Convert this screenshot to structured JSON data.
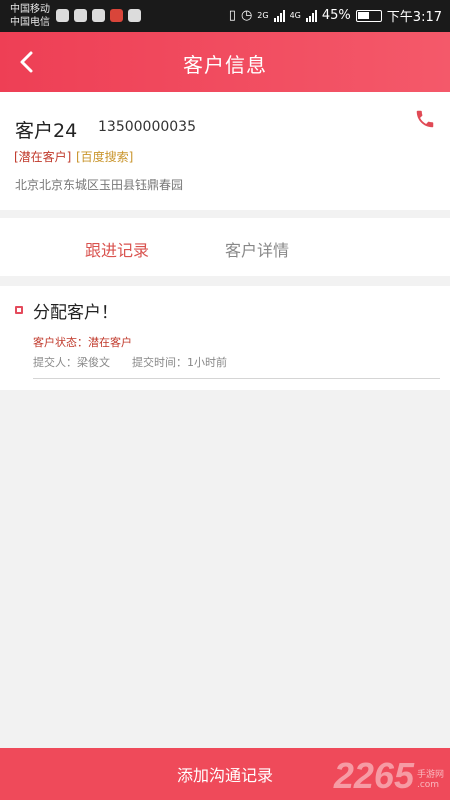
{
  "status_bar": {
    "carrier_1": "中国移动",
    "carrier_2": "中国电信",
    "signal_1_type": "2G",
    "signal_2_type": "4G",
    "battery": "45%",
    "time": "下午3:17"
  },
  "header": {
    "title": "客户信息",
    "back_icon": "chevron-left-icon"
  },
  "customer": {
    "name": "客户24",
    "phone": "13500000035",
    "tag_status": "[潜在客户]",
    "tag_source": "[百度搜索]",
    "address": "北京北京东城区玉田县钰鼎春园",
    "call_icon": "phone-icon"
  },
  "tabs": [
    {
      "label": "跟进记录",
      "active": true
    },
    {
      "label": "客户详情",
      "active": false
    }
  ],
  "records": [
    {
      "title": "分配客户！",
      "status": "客户状态：潜在客户",
      "submitter": "提交人：梁俊文",
      "submit_time": "提交时间：1小时前"
    }
  ],
  "bottom_bar": {
    "label": "添加沟通记录"
  },
  "watermark": {
    "number": "2265",
    "text_1": "手游网",
    "text_2": ".com"
  },
  "colors": {
    "accent": "#ef4a5a",
    "tag_status": "#c0392b",
    "tag_source": "#c9952c"
  }
}
